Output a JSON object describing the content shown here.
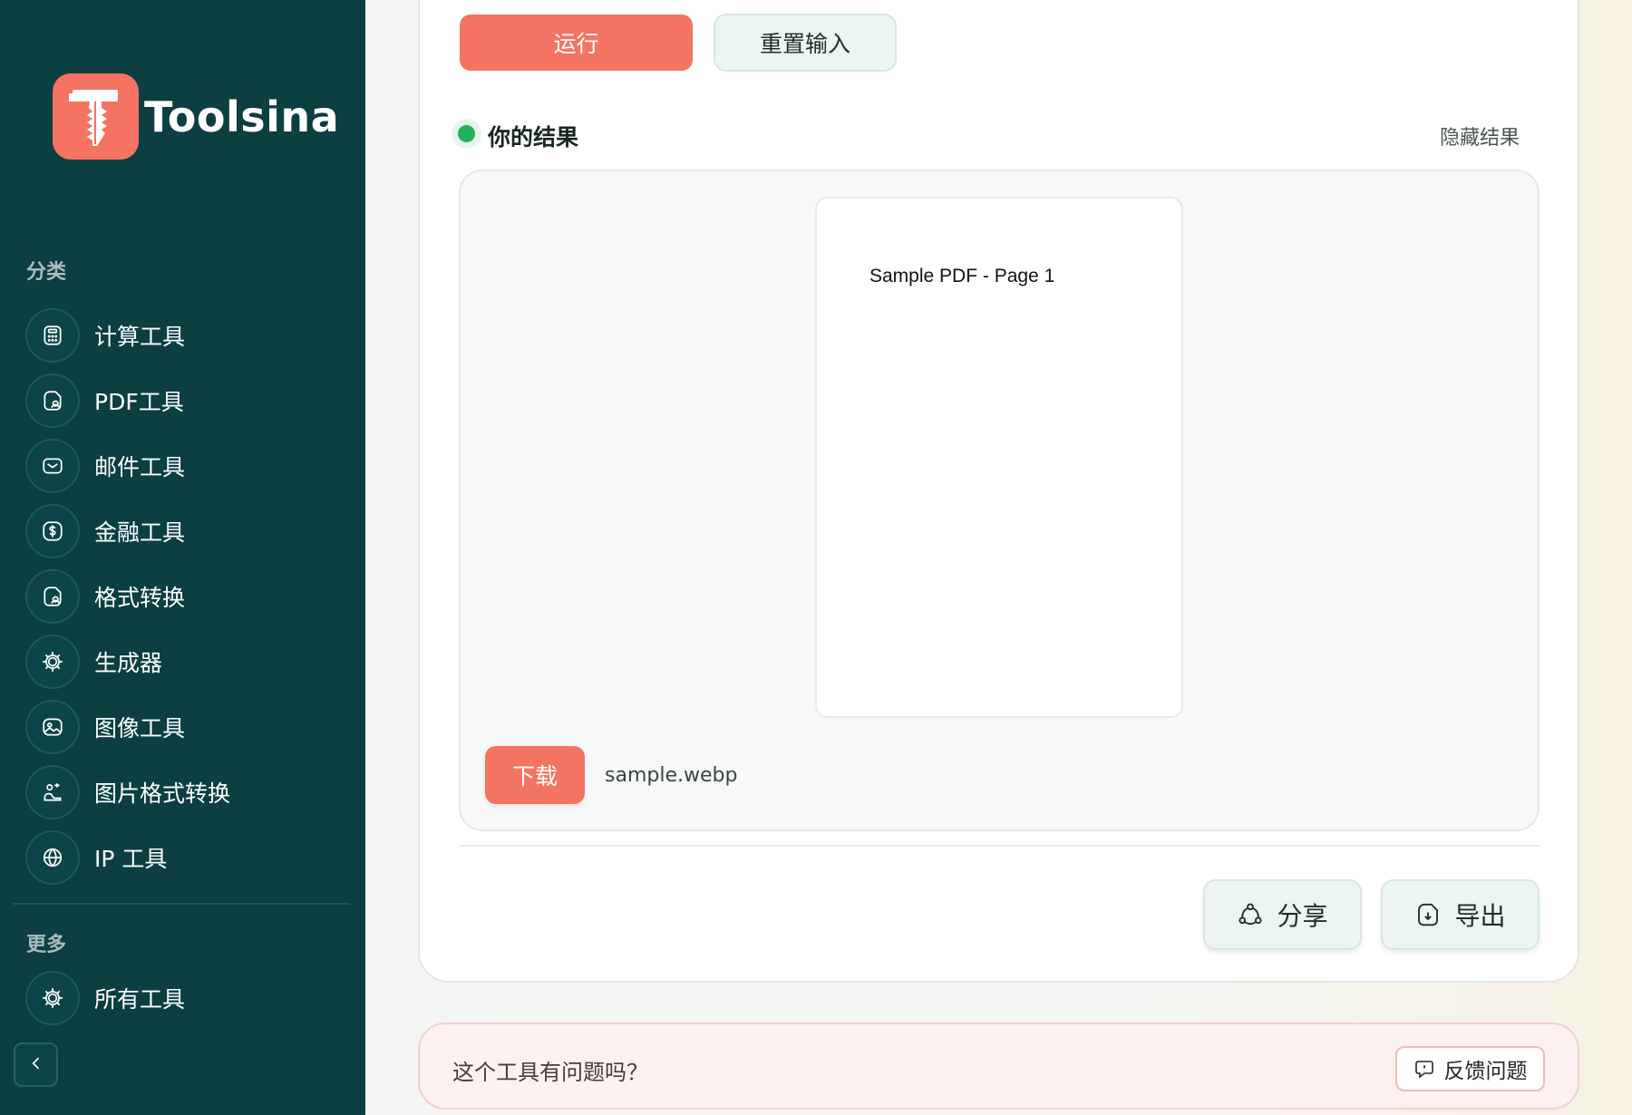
{
  "brand": {
    "name": "Toolsina",
    "logo_color": "#f47362"
  },
  "sidebar": {
    "categories_heading": "分类",
    "items": [
      {
        "label": "计算工具",
        "icon": "calculator-icon"
      },
      {
        "label": "PDF工具",
        "icon": "pdf-file-icon"
      },
      {
        "label": "邮件工具",
        "icon": "mail-icon"
      },
      {
        "label": "金融工具",
        "icon": "dollar-icon"
      },
      {
        "label": "格式转换",
        "icon": "file-convert-icon"
      },
      {
        "label": "生成器",
        "icon": "chip-icon"
      },
      {
        "label": "图像工具",
        "icon": "image-icon"
      },
      {
        "label": "图片格式转换",
        "icon": "image-convert-icon"
      },
      {
        "label": "IP 工具",
        "icon": "globe-icon"
      }
    ],
    "more_heading": "更多",
    "more_items": [
      {
        "label": "所有工具",
        "icon": "chip-icon"
      }
    ],
    "collapse_icon": "chevron-left-icon",
    "background": "#0b3f42"
  },
  "toolbar": {
    "run_label": "运行",
    "reset_label": "重置输入"
  },
  "result": {
    "title": "你的结果",
    "hide_label": "隐藏结果",
    "pdf_preview_text": "Sample PDF - Page 1",
    "download_label": "下载",
    "filename": "sample.webp",
    "status_color": "#21b05b"
  },
  "actions": {
    "share_label": "分享",
    "export_label": "导出"
  },
  "feedback": {
    "question": "这个工具有问题吗？",
    "report_label": "反馈问题"
  },
  "accent": "#f47463"
}
